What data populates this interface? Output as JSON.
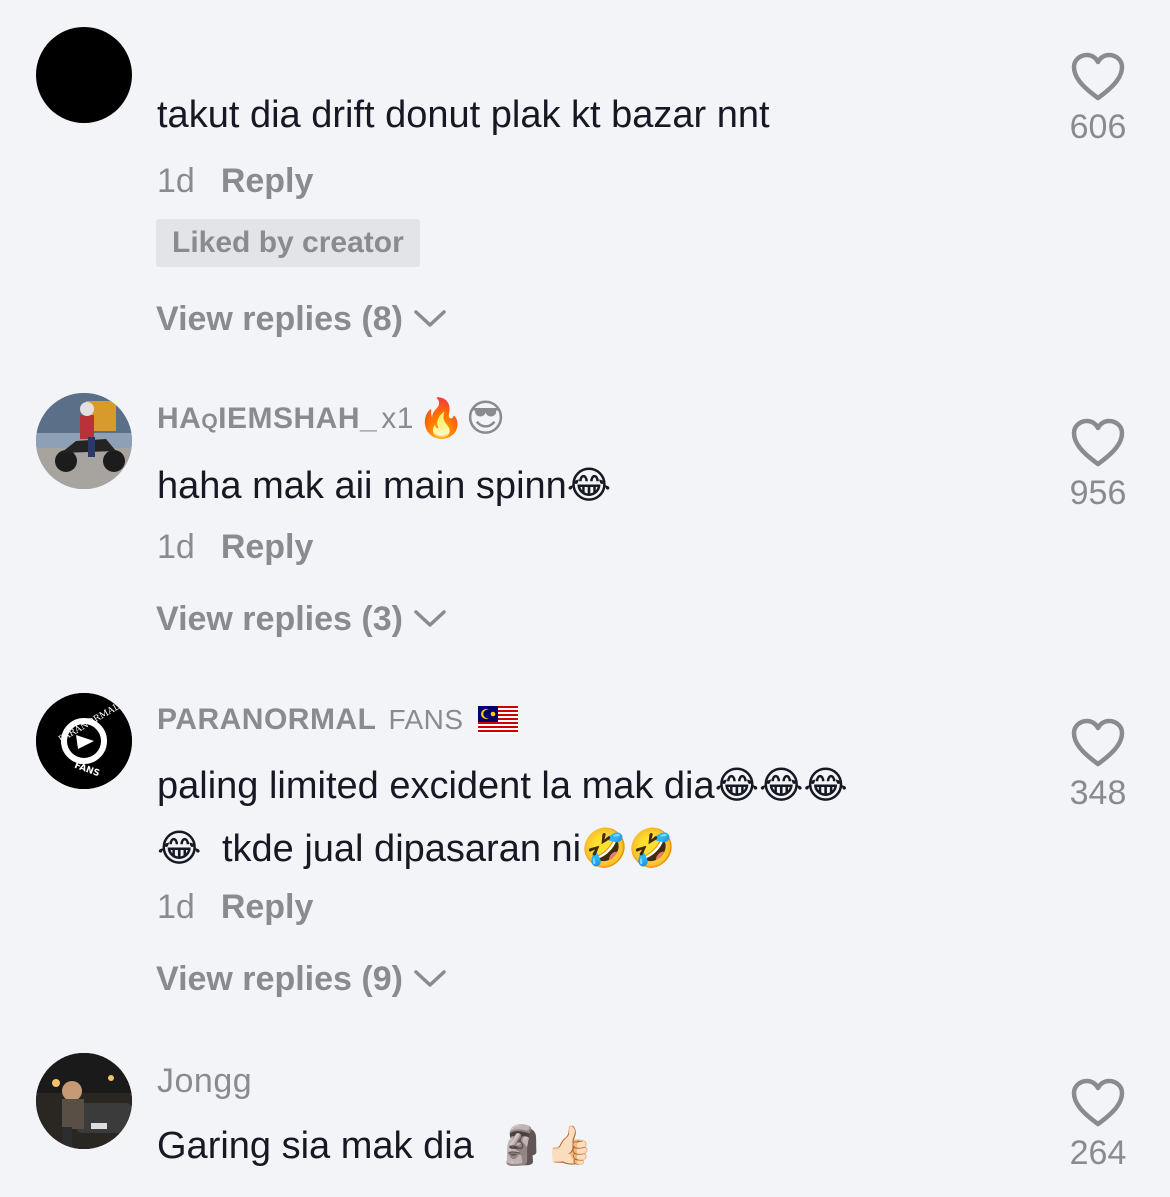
{
  "comments": [
    {
      "username": "",
      "text": "takut dia drift donut plak kt bazar nnt",
      "time": "1d",
      "reply_label": "Reply",
      "liked_badge": "Liked by creator",
      "view_replies": "View replies (8)",
      "likes": "606"
    },
    {
      "username_caps": "HAqIEMSHAH_",
      "username_rest": "x1",
      "username_emojis": "🔥😎",
      "text": "haha mak aii main spinn",
      "text_emoji": "😂",
      "time": "1d",
      "reply_label": "Reply",
      "view_replies": "View replies (3)",
      "likes": "956"
    },
    {
      "username_caps": "PARANORMAL",
      "username_rest": "FANS",
      "avatar_text_top": "PARANORMAL",
      "avatar_text_bottom": "FANS",
      "text_line1": "paling limited excident la mak dia",
      "text_line1_emojis": "😂😂😂",
      "text_line2_lead_emoji": "😂",
      "text_line2": "tkde jual dipasaran ni",
      "text_line2_emojis": "🤣🤣",
      "time": "1d",
      "reply_label": "Reply",
      "view_replies": "View replies (9)",
      "likes": "348"
    },
    {
      "username": "Jongg",
      "text": "Garing sia mak dia",
      "text_emojis": "🗿👍🏻",
      "likes": "264"
    }
  ],
  "icons": {
    "heart": "heart-outline-icon",
    "chevron": "chevron-down-icon"
  },
  "colors": {
    "background": "#f3f4f8",
    "text_primary": "#161823",
    "text_secondary": "#8a8b91"
  }
}
